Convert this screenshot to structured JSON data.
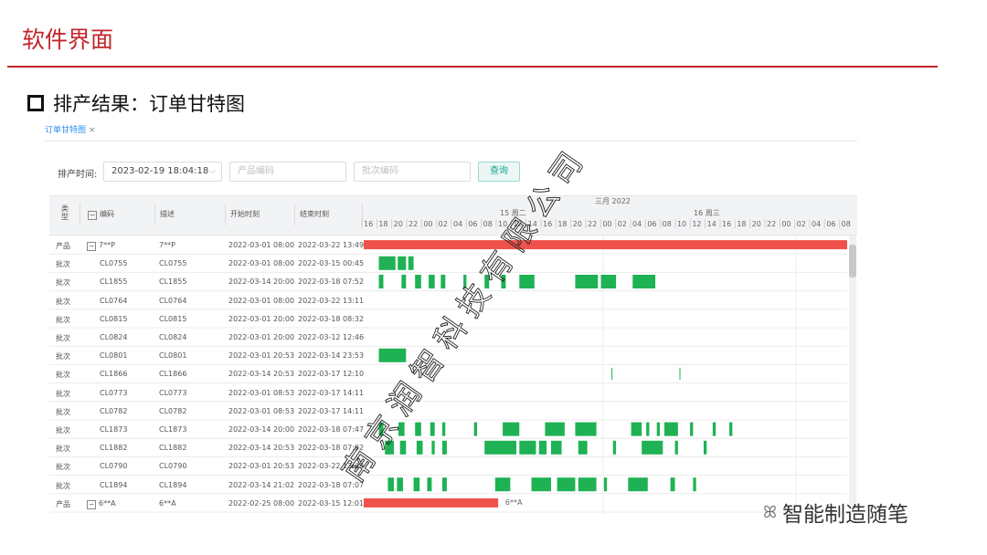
{
  "slide": {
    "title": "软件界面",
    "section_title": "排产结果：订单甘特图"
  },
  "tab": {
    "label": "订单甘特图",
    "close": "×"
  },
  "filters": {
    "time_label": "排产时间:",
    "time_value": "2023-02-19 18:04:18",
    "product_placeholder": "产品编码",
    "batch_placeholder": "批次编码",
    "query_label": "查询"
  },
  "columns": {
    "type": "类型",
    "code": "编码",
    "desc": "描述",
    "start": "开始时刻",
    "end": "结束时刻"
  },
  "timeline": {
    "month_label": "三月 2022",
    "days": [
      "15 周二",
      "16 周三"
    ],
    "hours": [
      "16",
      "18",
      "20",
      "22",
      "00",
      "02",
      "04",
      "06",
      "08",
      "10",
      "12",
      "14",
      "16",
      "18",
      "20",
      "22",
      "00",
      "02",
      "04",
      "06",
      "08",
      "10",
      "12",
      "14",
      "16",
      "18",
      "20",
      "22",
      "00",
      "02",
      "04",
      "06",
      "08"
    ]
  },
  "rows": [
    {
      "type": "产品",
      "code": "7**P",
      "desc": "7**P",
      "start": "2022-03-01 08:00",
      "end": "2022-03-22 13:49",
      "expand": true
    },
    {
      "type": "批次",
      "code": "CL0755",
      "desc": "CL0755",
      "start": "2022-03-01 08:00",
      "end": "2022-03-15 00:45"
    },
    {
      "type": "批次",
      "code": "CL1855",
      "desc": "CL1855",
      "start": "2022-03-14 20:00",
      "end": "2022-03-18 07:52"
    },
    {
      "type": "批次",
      "code": "CL0764",
      "desc": "CL0764",
      "start": "2022-03-01 08:00",
      "end": "2022-03-22 13:11"
    },
    {
      "type": "批次",
      "code": "CL0815",
      "desc": "CL0815",
      "start": "2022-03-01 20:00",
      "end": "2022-03-18 08:32"
    },
    {
      "type": "批次",
      "code": "CL0824",
      "desc": "CL0824",
      "start": "2022-03-01 20:00",
      "end": "2022-03-12 12:46"
    },
    {
      "type": "批次",
      "code": "CL0801",
      "desc": "CL0801",
      "start": "2022-03-01 20:53",
      "end": "2022-03-14 23:53"
    },
    {
      "type": "批次",
      "code": "CL1866",
      "desc": "CL1866",
      "start": "2022-03-14 20:53",
      "end": "2022-03-17 12:10"
    },
    {
      "type": "批次",
      "code": "CL0773",
      "desc": "CL0773",
      "start": "2022-03-01 08:53",
      "end": "2022-03-17 14:11"
    },
    {
      "type": "批次",
      "code": "CL0782",
      "desc": "CL0782",
      "start": "2022-03-01 08:53",
      "end": "2022-03-17 14:11"
    },
    {
      "type": "批次",
      "code": "CL1873",
      "desc": "CL1873",
      "start": "2022-03-14 20:00",
      "end": "2022-03-18 07:47"
    },
    {
      "type": "批次",
      "code": "CL1882",
      "desc": "CL1882",
      "start": "2022-03-14 20:53",
      "end": "2022-03-18 07:02"
    },
    {
      "type": "批次",
      "code": "CL0790",
      "desc": "CL0790",
      "start": "2022-03-01 20:53",
      "end": "2022-03-22 13:49"
    },
    {
      "type": "批次",
      "code": "CL1894",
      "desc": "CL1894",
      "start": "2022-03-14 21:02",
      "end": "2022-03-18 07:07"
    },
    {
      "type": "产品",
      "code": "6**A",
      "desc": "6**A",
      "start": "2022-02-25 08:00",
      "end": "2022-03-15 12:01",
      "expand": true
    }
  ],
  "chart_data": {
    "type": "gantt",
    "x_unit": "hours from 2022-03-14 16:00",
    "x_range": [
      0,
      64
    ],
    "product_color": "#f0524b",
    "batch_color": "#1fb254",
    "bars": [
      [
        [
          0,
          64
        ]
      ],
      [
        [
          2.0,
          4.2
        ],
        [
          4.5,
          5.6
        ],
        [
          5.9,
          6.6
        ]
      ],
      [
        [
          2.0,
          2.6
        ],
        [
          5.0,
          5.6
        ],
        [
          6.8,
          7.6
        ],
        [
          8.6,
          9.4
        ],
        [
          10.2,
          10.8
        ],
        [
          13.2,
          13.6
        ],
        [
          16.0,
          16.6
        ],
        [
          18.2,
          18.8
        ],
        [
          20.6,
          22.6
        ],
        [
          28.0,
          31.0
        ],
        [
          31.4,
          33.4
        ],
        [
          35.6,
          38.6
        ]
      ],
      [],
      [],
      [],
      [
        [
          2.0,
          5.6
        ]
      ],
      [
        [
          32.8,
          32.9
        ],
        [
          41.8,
          41.9
        ]
      ],
      [],
      [],
      [
        [
          2.0,
          2.6
        ],
        [
          4.6,
          5.4
        ],
        [
          6.8,
          7.6
        ],
        [
          8.8,
          9.4
        ],
        [
          10.4,
          10.8
        ],
        [
          14.6,
          15.0
        ],
        [
          18.4,
          20.6
        ],
        [
          24.0,
          26.6
        ],
        [
          28.0,
          30.8
        ],
        [
          35.4,
          36.8
        ],
        [
          37.4,
          37.8
        ],
        [
          38.8,
          39.2
        ],
        [
          39.8,
          41.6
        ],
        [
          43.2,
          43.6
        ],
        [
          46.2,
          46.6
        ],
        [
          48.4,
          48.8
        ]
      ],
      [
        [
          2.8,
          4.0
        ],
        [
          4.8,
          5.6
        ],
        [
          7.0,
          7.8
        ],
        [
          9.0,
          9.4
        ],
        [
          10.4,
          11.0
        ],
        [
          16.0,
          20.2
        ],
        [
          20.6,
          22.8
        ],
        [
          23.2,
          24.2
        ],
        [
          24.8,
          26.2
        ],
        [
          28.4,
          29.6
        ],
        [
          33.0,
          33.4
        ],
        [
          36.8,
          39.6
        ],
        [
          41.2,
          41.6
        ],
        [
          45.0,
          45.4
        ]
      ],
      [],
      [
        [
          3.2,
          4.0
        ],
        [
          4.4,
          5.2
        ],
        [
          6.6,
          7.4
        ],
        [
          8.4,
          9.0
        ],
        [
          10.4,
          11.0
        ],
        [
          17.4,
          19.4
        ],
        [
          22.2,
          24.8
        ],
        [
          25.6,
          28.0
        ],
        [
          28.4,
          30.8
        ],
        [
          31.8,
          32.2
        ],
        [
          35.0,
          37.6
        ],
        [
          40.6,
          41.2
        ],
        [
          43.6,
          44.0
        ]
      ],
      [
        [
          0,
          17.8
        ]
      ]
    ],
    "annotations": [
      {
        "row": 14,
        "x": 18.5,
        "text": "6**A"
      }
    ]
  },
  "brand": {
    "wechat": "ꕤ",
    "text": "智能制造随笔"
  },
  "watermark": {
    "text": "南京润智科技有限公司"
  }
}
